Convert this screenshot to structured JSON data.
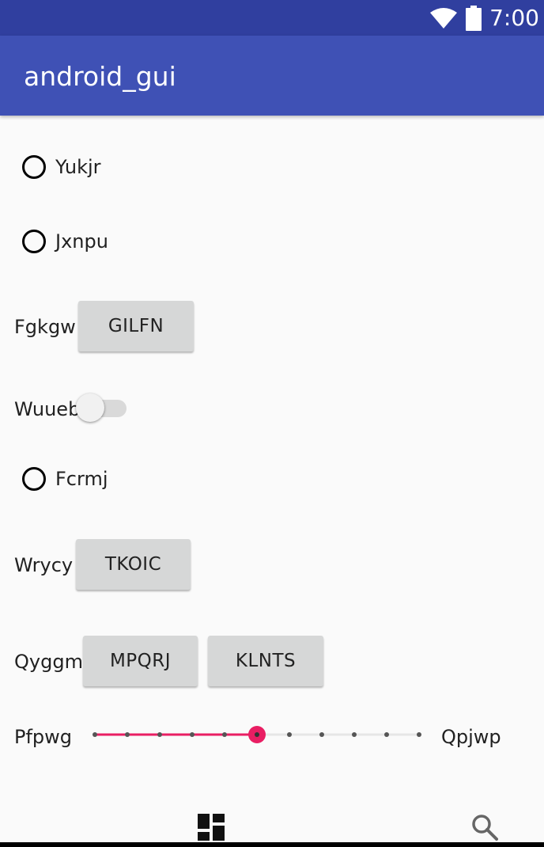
{
  "status_bar": {
    "time": "7:00"
  },
  "app_bar": {
    "title": "android_gui"
  },
  "radios": [
    {
      "label": "Yukjr",
      "checked": false
    },
    {
      "label": "Jxnpu",
      "checked": false
    },
    {
      "label": "Fcrmj",
      "checked": false
    }
  ],
  "row_fgkgw": {
    "label": "Fgkgw",
    "button": "GILFN"
  },
  "row_switch": {
    "label": "Wuueb",
    "on": false
  },
  "row_wrycy": {
    "label": "Wrycy",
    "button": "TKOIC"
  },
  "row_qyggm": {
    "label": "Qyggm",
    "buttons": [
      "MPQRJ",
      "KLNTS"
    ]
  },
  "slider_row": {
    "left_label": "Pfpwg",
    "right_label": "Qpjwp",
    "steps": 10,
    "value": 5,
    "accent": "#e91e63"
  },
  "bottom_nav": {
    "icons": [
      "dashboard-icon",
      "search-icon"
    ]
  },
  "colors": {
    "status_bar": "#303f9f",
    "app_bar": "#3f51b5",
    "accent": "#e91e63"
  }
}
